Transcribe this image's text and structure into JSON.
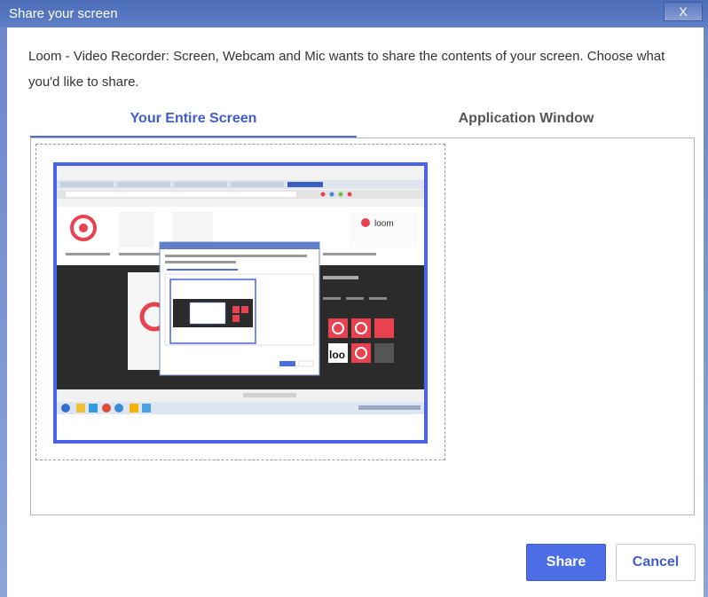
{
  "window": {
    "title": "Share your screen",
    "close_glyph": "X"
  },
  "message": "Loom - Video Recorder: Screen, Webcam and Mic wants to share the contents of your screen. Choose what you'd like to share.",
  "tabs": [
    {
      "label": "Your Entire Screen",
      "selected": true
    },
    {
      "label": "Application Window",
      "selected": false
    }
  ],
  "thumbnail": {
    "brand_text": "loom",
    "lo_text": "loo"
  },
  "buttons": {
    "share": "Share",
    "cancel": "Cancel"
  },
  "colors": {
    "accent": "#4b6de6",
    "title_bar": "#4b6db8",
    "loom_red": "#e8414f"
  }
}
